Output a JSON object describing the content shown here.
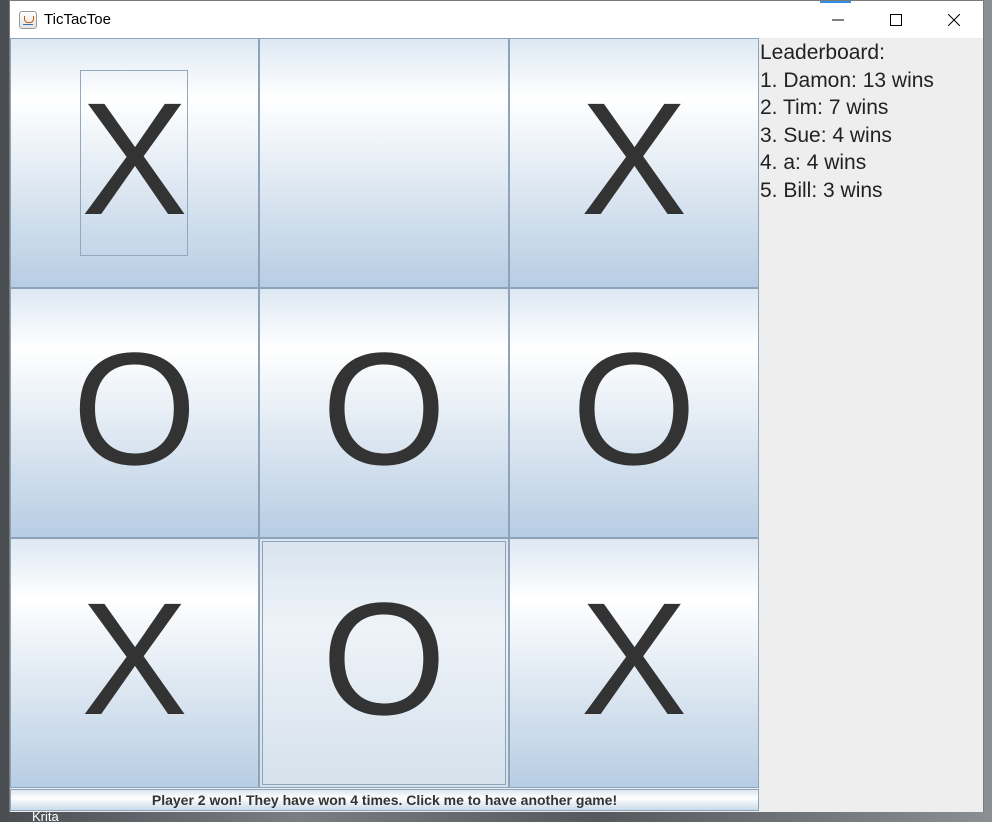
{
  "window": {
    "title": "TicTacToe",
    "controls": [
      "minimize-icon",
      "maximize-icon",
      "close-icon"
    ]
  },
  "board": {
    "cells": [
      {
        "mark": "X"
      },
      {
        "mark": ""
      },
      {
        "mark": "X"
      },
      {
        "mark": "O"
      },
      {
        "mark": "O"
      },
      {
        "mark": "O"
      },
      {
        "mark": "X"
      },
      {
        "mark": "O"
      },
      {
        "mark": "X"
      }
    ]
  },
  "leaderboard": {
    "title": "Leaderboard:",
    "entries": [
      "1. Damon: 13 wins",
      "2. Tim: 7 wins",
      "3. Sue: 4 wins",
      "4. a: 4 wins",
      "5. Bill: 3 wins"
    ]
  },
  "status": {
    "message": "Player 2 won! They have won 4 times. Click me to have another game!"
  },
  "desktop": {
    "taskbar_label": "Krita"
  },
  "colors": {
    "accent": "#2f8fe6",
    "mark": "#333333"
  }
}
